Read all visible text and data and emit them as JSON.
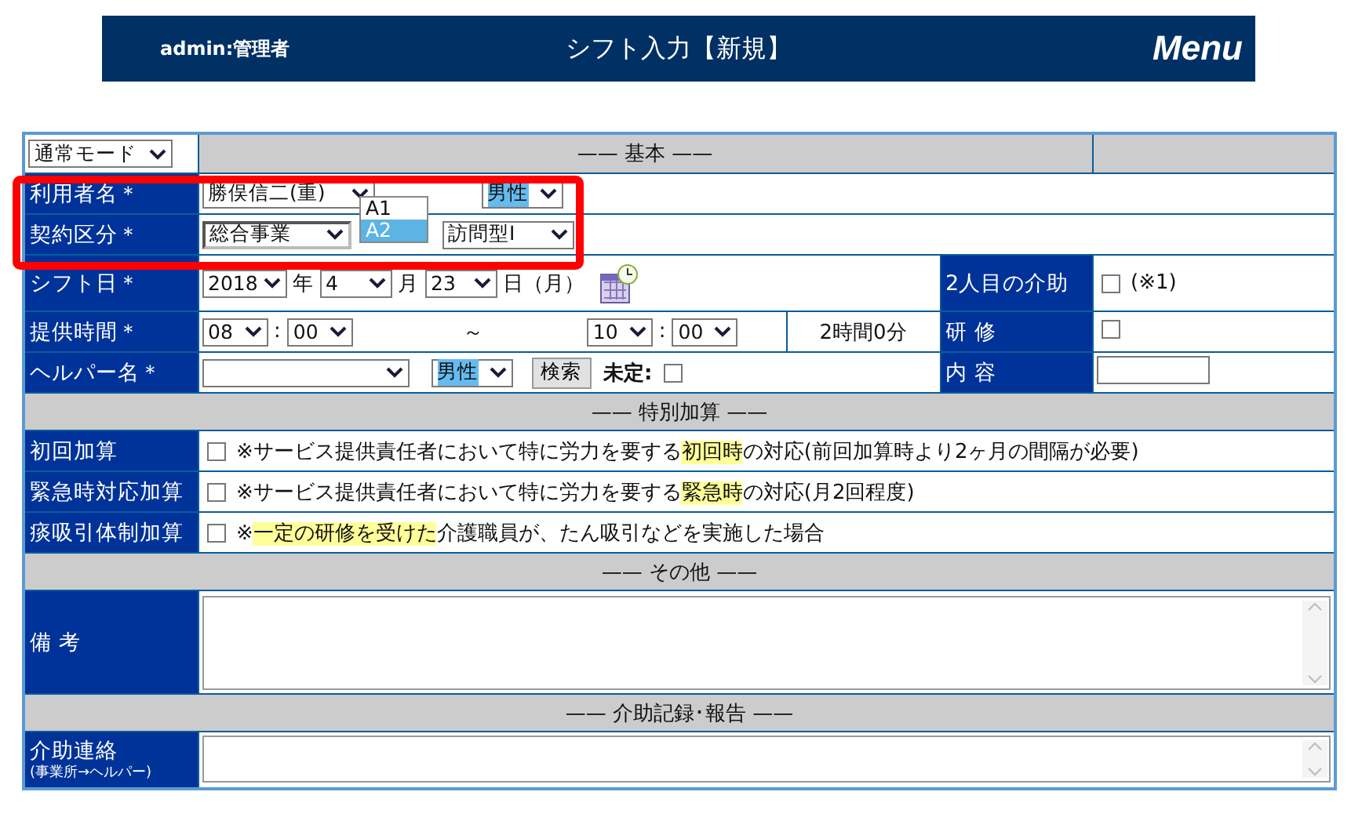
{
  "header": {
    "user": "admin:管理者",
    "title": "シフト入力【新規】",
    "menu": "Menu"
  },
  "mode_select": "通常モード",
  "section_basic": "—— 基本 ——",
  "user_row": {
    "label": "利用者名＊",
    "user": "勝俣信二(重)",
    "gender": "男性"
  },
  "contract_row": {
    "label": "契約区分＊",
    "category": "総合事業",
    "service_type": "訪問型Ⅰ",
    "dropdown": [
      {
        "label": "A1",
        "selected": false
      },
      {
        "label": "A2",
        "selected": true
      }
    ]
  },
  "shift_date_row": {
    "label": "シフト日＊",
    "year": "2018",
    "year_unit": "年",
    "month": "4",
    "month_unit": "月",
    "day": "23",
    "day_unit": "日（月）",
    "second_helper": {
      "label": "2人目の介助",
      "checked": false,
      "note": "(※1)"
    }
  },
  "time_row": {
    "label": "提供時間＊",
    "start_hour": "08",
    "start_separator": ":",
    "start_minute": "00",
    "tilde": "～",
    "end_hour": "10",
    "end_separator": ":",
    "end_minute": "00",
    "duration": "2時間0分",
    "training": {
      "label": "研  修",
      "checked": false
    }
  },
  "helper_row": {
    "label": "ヘルパー名＊",
    "gender": "男性",
    "search_button": "検索",
    "undecided": {
      "label": "未定:",
      "checked": false
    },
    "content": {
      "label": "内  容"
    }
  },
  "special_section": "—— 特別加算 ——",
  "special_items": [
    {
      "label": "初回加算",
      "checked": false,
      "before": "※サービス提供責任者において特に労力を要する",
      "highlight": "初回時",
      "after": "の対応(前回加算時より2ヶ月の間隔が必要)"
    },
    {
      "label": "緊急時対応加算",
      "checked": false,
      "before": "※サービス提供責任者において特に労力を要する",
      "highlight": "緊急時",
      "after": "の対応(月2回程度)"
    },
    {
      "label": "痰吸引体制加算",
      "checked": false,
      "before": "※",
      "highlight": "一定の研修を受けた",
      "after": "介護職員が、たん吸引などを実施した場合"
    }
  ],
  "other_section": "—— その他 ——",
  "remarks": {
    "label": "備  考"
  },
  "report_section": "—— 介助記録･報告 ——",
  "contact": {
    "label": "介助連絡",
    "sublabel": "(事業所→ヘルパー)"
  }
}
